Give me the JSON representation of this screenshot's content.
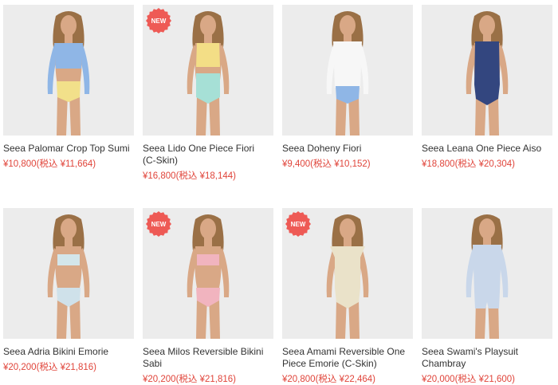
{
  "products": [
    {
      "name": "Seea Palomar Crop Top Sumi",
      "price": "¥10,800(税込 ¥11,664)",
      "badge": "",
      "top_color": "#8fb6e6",
      "bottom_color": "#f2e08a",
      "style": "croptop"
    },
    {
      "name": "Seea Lido One Piece Fiori (C-Skin)",
      "price": "¥16,800(税込 ¥18,144)",
      "badge": "NEW",
      "top_color": "#f3de86",
      "bottom_color": "#a6e0d6",
      "style": "highwaist"
    },
    {
      "name": "Seea Doheny Fiori",
      "price": "¥9,400(税込 ¥10,152)",
      "badge": "",
      "top_color": "#f7f7f7",
      "bottom_color": "#8fb6e6",
      "style": "rashguard"
    },
    {
      "name": "Seea Leana One Piece Aiso",
      "price": "¥18,800(税込 ¥20,304)",
      "badge": "",
      "top_color": "#33467f",
      "bottom_color": "#33467f",
      "style": "onepiece"
    },
    {
      "name": "Seea Adria Bikini Emorie",
      "price": "¥20,200(税込 ¥21,816)",
      "badge": "",
      "top_color": "#d3e6ea",
      "bottom_color": "#cfe1ea",
      "style": "bikini"
    },
    {
      "name": "Seea Milos Reversible Bikini Sabi",
      "price": "¥20,200(税込 ¥21,816)",
      "badge": "NEW",
      "top_color": "#f1b4bf",
      "bottom_color": "#f1b4bf",
      "style": "bikini"
    },
    {
      "name": "Seea Amami Reversible One Piece Emorie (C-Skin)",
      "price": "¥20,800(税込 ¥22,464)",
      "badge": "NEW",
      "top_color": "#eae2c9",
      "bottom_color": "#eae2c9",
      "style": "capsleeve"
    },
    {
      "name": "Seea Swami's Playsuit Chambray",
      "price": "¥20,000(税込 ¥21,600)",
      "badge": "",
      "top_color": "#c9d7ea",
      "bottom_color": "#c9d7ea",
      "style": "playsuit"
    }
  ],
  "colors": {
    "price": "#e0443a",
    "badge": "#ee5a55",
    "skin": "#d9a886",
    "hair": "#9a7046",
    "photo_bg": "#ececec"
  }
}
